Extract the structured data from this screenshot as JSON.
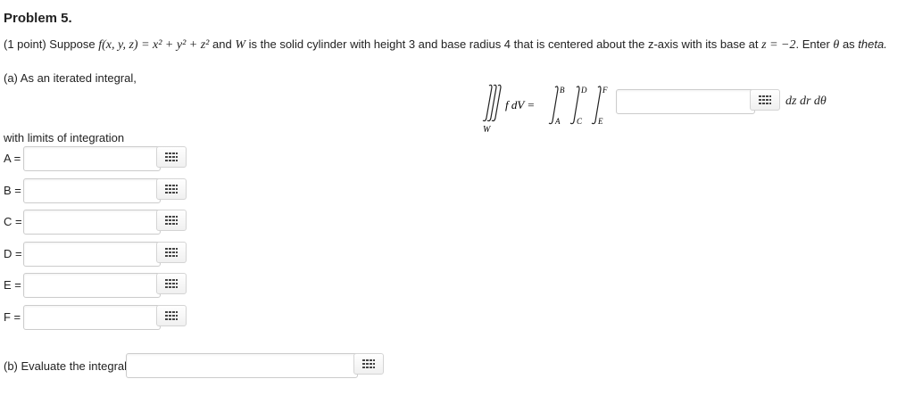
{
  "problem": {
    "title": "Problem 5.",
    "points": "(1 point) Suppose",
    "func": "f(x, y, z) = x² + y² + z²",
    "and": "and",
    "W": "W",
    "desc": "is the solid cylinder with height 3 and base radius 4 that is centered about the z-axis with its base at",
    "zeq": "z = −2",
    "enter": ". Enter",
    "theta": "θ",
    "as": "as",
    "theta_word": "theta."
  },
  "part_a": {
    "label": "(a) As an iterated integral,",
    "differentials": "dz dr dθ",
    "integral": {
      "lhs_integrand": "f dV =",
      "region": "W",
      "lower": [
        "A",
        "C",
        "E"
      ],
      "upper": [
        "B",
        "D",
        "F"
      ]
    },
    "answer_value": ""
  },
  "limits": {
    "label": "with limits of integration",
    "rows": [
      {
        "label": "A =",
        "value": ""
      },
      {
        "label": "B =",
        "value": ""
      },
      {
        "label": "C =",
        "value": ""
      },
      {
        "label": "D =",
        "value": ""
      },
      {
        "label": "E =",
        "value": ""
      },
      {
        "label": "F =",
        "value": ""
      }
    ]
  },
  "part_b": {
    "label": "(b) Evaluate the integral.",
    "answer_value": ""
  },
  "icons": {
    "keypad": "keypad-icon"
  }
}
